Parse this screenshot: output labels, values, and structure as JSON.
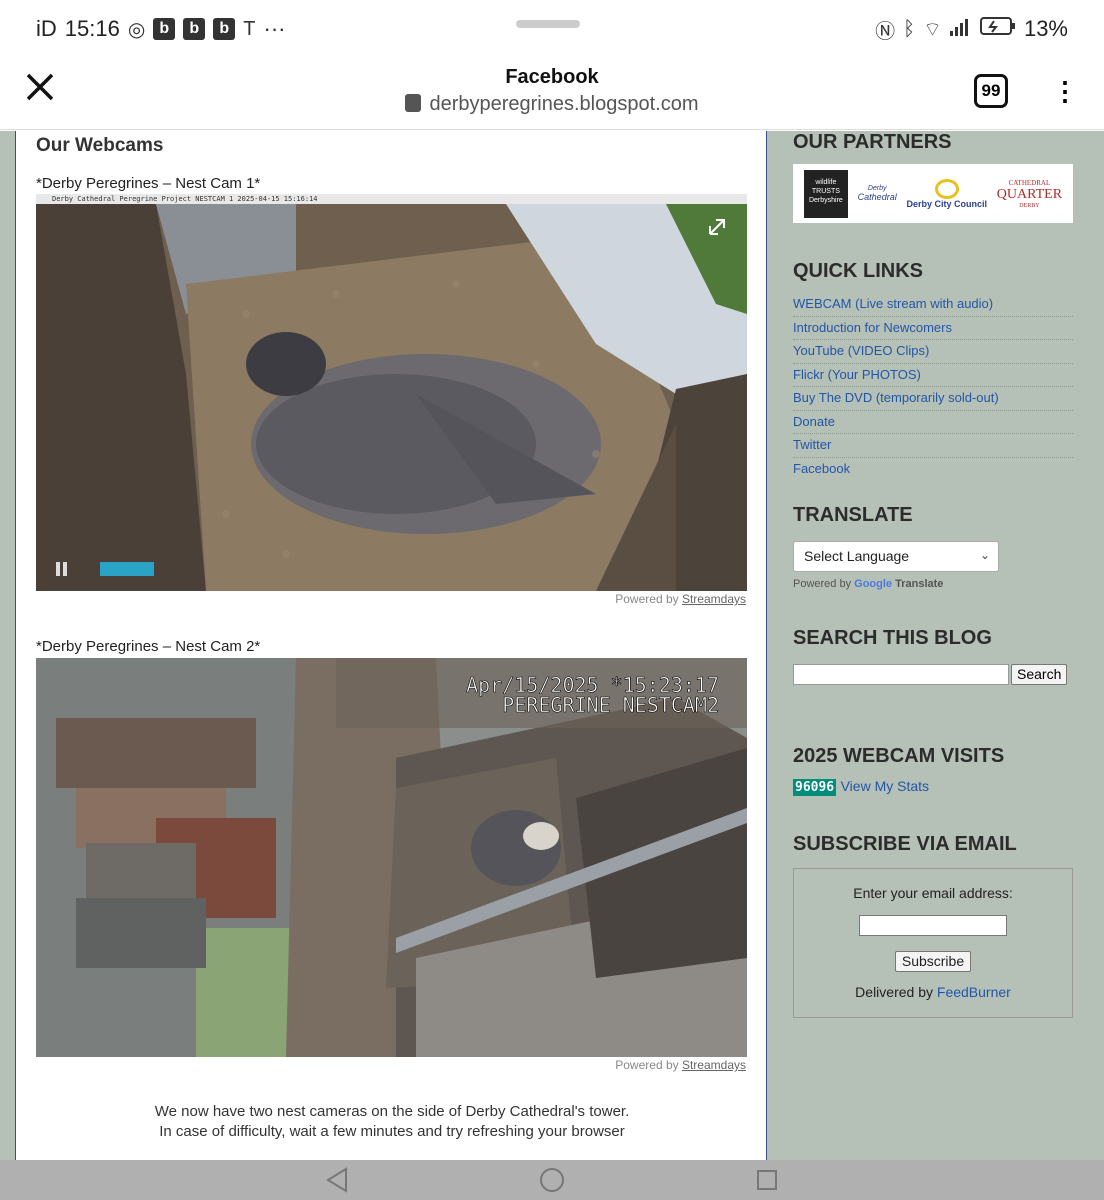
{
  "status_bar": {
    "left_text": "iD",
    "time": "15:16",
    "app_badges": [
      "b",
      "b",
      "b"
    ],
    "more": "···",
    "battery": "13%"
  },
  "browser": {
    "title": "Facebook",
    "url": "derbyperegrines.blogspot.com",
    "tab_count": "99"
  },
  "main": {
    "heading": "Our Webcams",
    "cam1": {
      "label": "*Derby Peregrines – Nest Cam 1*",
      "overlay": "Derby Cathedral Peregrine Project  NESTCAM 1  2025-04-15 15:16:14",
      "powered_prefix": "Powered by",
      "powered_link": "Streamdays"
    },
    "cam2": {
      "label": "*Derby Peregrines – Nest Cam 2*",
      "overlay_line1": "Apr/15/2025 *15:23:17",
      "overlay_line2": "PEREGRINE NESTCAM2",
      "powered_prefix": "Powered by",
      "powered_link": "Streamdays"
    },
    "text_line1": "We now have two nest cameras on the side of Derby Cathedral's tower.",
    "text_line2": "In case of difficulty, wait a few minutes and try refreshing your browser"
  },
  "sidebar": {
    "partners_heading": "OUR PARTNERS",
    "partners": {
      "wildlife": "wildlife TRUSTS",
      "wildlife_sub": "Derbyshire",
      "cathedral_top": "Derby",
      "cathedral": "Cathedral",
      "council": "Derby City Council",
      "quarter_top": "CATHEDRAL",
      "quarter": "QUARTER",
      "quarter_sub": "DERBY"
    },
    "quick_links_heading": "QUICK LINKS",
    "quick_links": [
      "WEBCAM (Live stream with audio)",
      "Introduction for Newcomers",
      "YouTube (VIDEO Clips)",
      "Flickr (Your PHOTOS)",
      "Buy The DVD (temporarily sold-out)",
      "Donate",
      "Twitter",
      "Facebook"
    ],
    "translate_heading": "TRANSLATE",
    "translate_select": "Select Language",
    "translate_powered": "Powered by",
    "translate_google": "Google",
    "translate_word": "Translate",
    "search_heading": "SEARCH THIS BLOG",
    "search_button": "Search",
    "visits_heading": "2025 WEBCAM VISITS",
    "visits_count": "96096",
    "visits_link": "View My Stats",
    "subscribe_heading": "SUBSCRIBE VIA EMAIL",
    "subscribe_prompt": "Enter your email address:",
    "subscribe_button": "Subscribe",
    "delivered_by": "Delivered by",
    "feedburner": "FeedBurner"
  }
}
